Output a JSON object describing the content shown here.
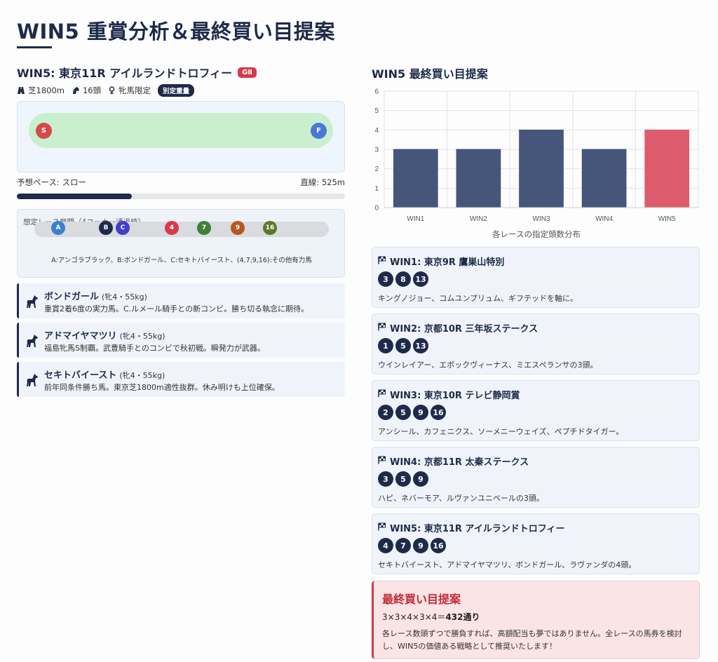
{
  "page": {
    "title": "WIN5 重賞分析＆最終買い目提案"
  },
  "race": {
    "title": "WIN5: 東京11R アイルランドトロフィー",
    "grade": "GⅡ",
    "course": "芝1800m",
    "runners": "16頭",
    "condition": "牝馬限定",
    "weight_rule": "別定重量",
    "start_marker": "S",
    "finish_marker": "F",
    "pace_label": "予想ペース: スロー",
    "straight_label": "直線: 525m",
    "pace_level": 0.35,
    "formation_label": "想定レース展開（4コーナー通過時）",
    "formation_horses": [
      {
        "label": "A",
        "color": "#3f7fcf"
      },
      {
        "label": "B",
        "color": "#1e2a4a"
      },
      {
        "label": "C",
        "color": "#3f3fc8"
      },
      {
        "label": "4",
        "color": "#d63a4a"
      },
      {
        "label": "7",
        "color": "#3f7f3a"
      },
      {
        "label": "9",
        "color": "#b5581f"
      },
      {
        "label": "16",
        "color": "#5a7a2a"
      }
    ],
    "formation_legend": "A:アンゴラブラック、B:ボンドガール、C:セキトバイースト、(4,7,9,16):その他有力馬"
  },
  "horses": [
    {
      "name": "ボンドガール",
      "info": "(牝4・55kg)",
      "desc": "重賞2着6度の実力馬。C.ルメール騎手との新コンビ。勝ち切る執念に期待。"
    },
    {
      "name": "アドマイヤマツリ",
      "info": "(牝4・55kg)",
      "desc": "福島牝馬S制覇。武豊騎手とのコンビで秋初戦。瞬発力が武器。"
    },
    {
      "name": "セキトバイースト",
      "info": "(牝4・55kg)",
      "desc": "前年同条件勝ち馬。東京芝1800m適性抜群。休み明けも上位確保。"
    }
  ],
  "chart_heading": "WIN5 最終買い目提案",
  "chart_data": {
    "type": "bar",
    "categories": [
      "WIN1",
      "WIN2",
      "WIN3",
      "WIN4",
      "WIN5"
    ],
    "values": [
      3,
      3,
      4,
      3,
      4
    ],
    "ylim": [
      0,
      6
    ],
    "yticks": [
      "0",
      "1",
      "2",
      "3",
      "4",
      "5",
      "6"
    ],
    "xlabel": "各レースの指定頭数分布",
    "grid": true,
    "colors": [
      "#46557a",
      "#46557a",
      "#46557a",
      "#46557a",
      "#dc5c6e"
    ]
  },
  "wins": [
    {
      "title": "WIN1: 東京9R 鷹巣山特別",
      "picks": [
        "3",
        "8",
        "13"
      ],
      "desc": "キングノジョー、コムユンプリュム、ギフテッドを軸に。"
    },
    {
      "title": "WIN2: 京都10R 三年坂ステークス",
      "picks": [
        "1",
        "5",
        "13"
      ],
      "desc": "ウインレイアー、エポックヴィーナス、ミエスペランサの3頭。"
    },
    {
      "title": "WIN3: 東京10R テレビ静岡賞",
      "picks": [
        "2",
        "5",
        "9",
        "16"
      ],
      "desc": "アンシール、カフェニクス、ソーメニーウェイズ、ペプチドタイガー。"
    },
    {
      "title": "WIN4: 京都11R 太秦ステークス",
      "picks": [
        "3",
        "5",
        "9"
      ],
      "desc": "ハピ、ネバーモア、ルヴァンユニベールの3頭。"
    },
    {
      "title": "WIN5: 東京11R アイルランドトロフィー",
      "picks": [
        "4",
        "7",
        "9",
        "16"
      ],
      "desc": "セキトバイースト、アドマイヤマツリ、ボンドガール、ラヴァンダの4頭。"
    }
  ],
  "final": {
    "title": "最終買い目提案",
    "formula_prefix": "3×3×4×3×4＝",
    "formula_total": "432通り",
    "desc": "各レース数頭ずつで勝負すれば、高額配当も夢ではありません。全レースの馬券を検討し、WIN5の価値ある戦略として推奨いたします！"
  }
}
